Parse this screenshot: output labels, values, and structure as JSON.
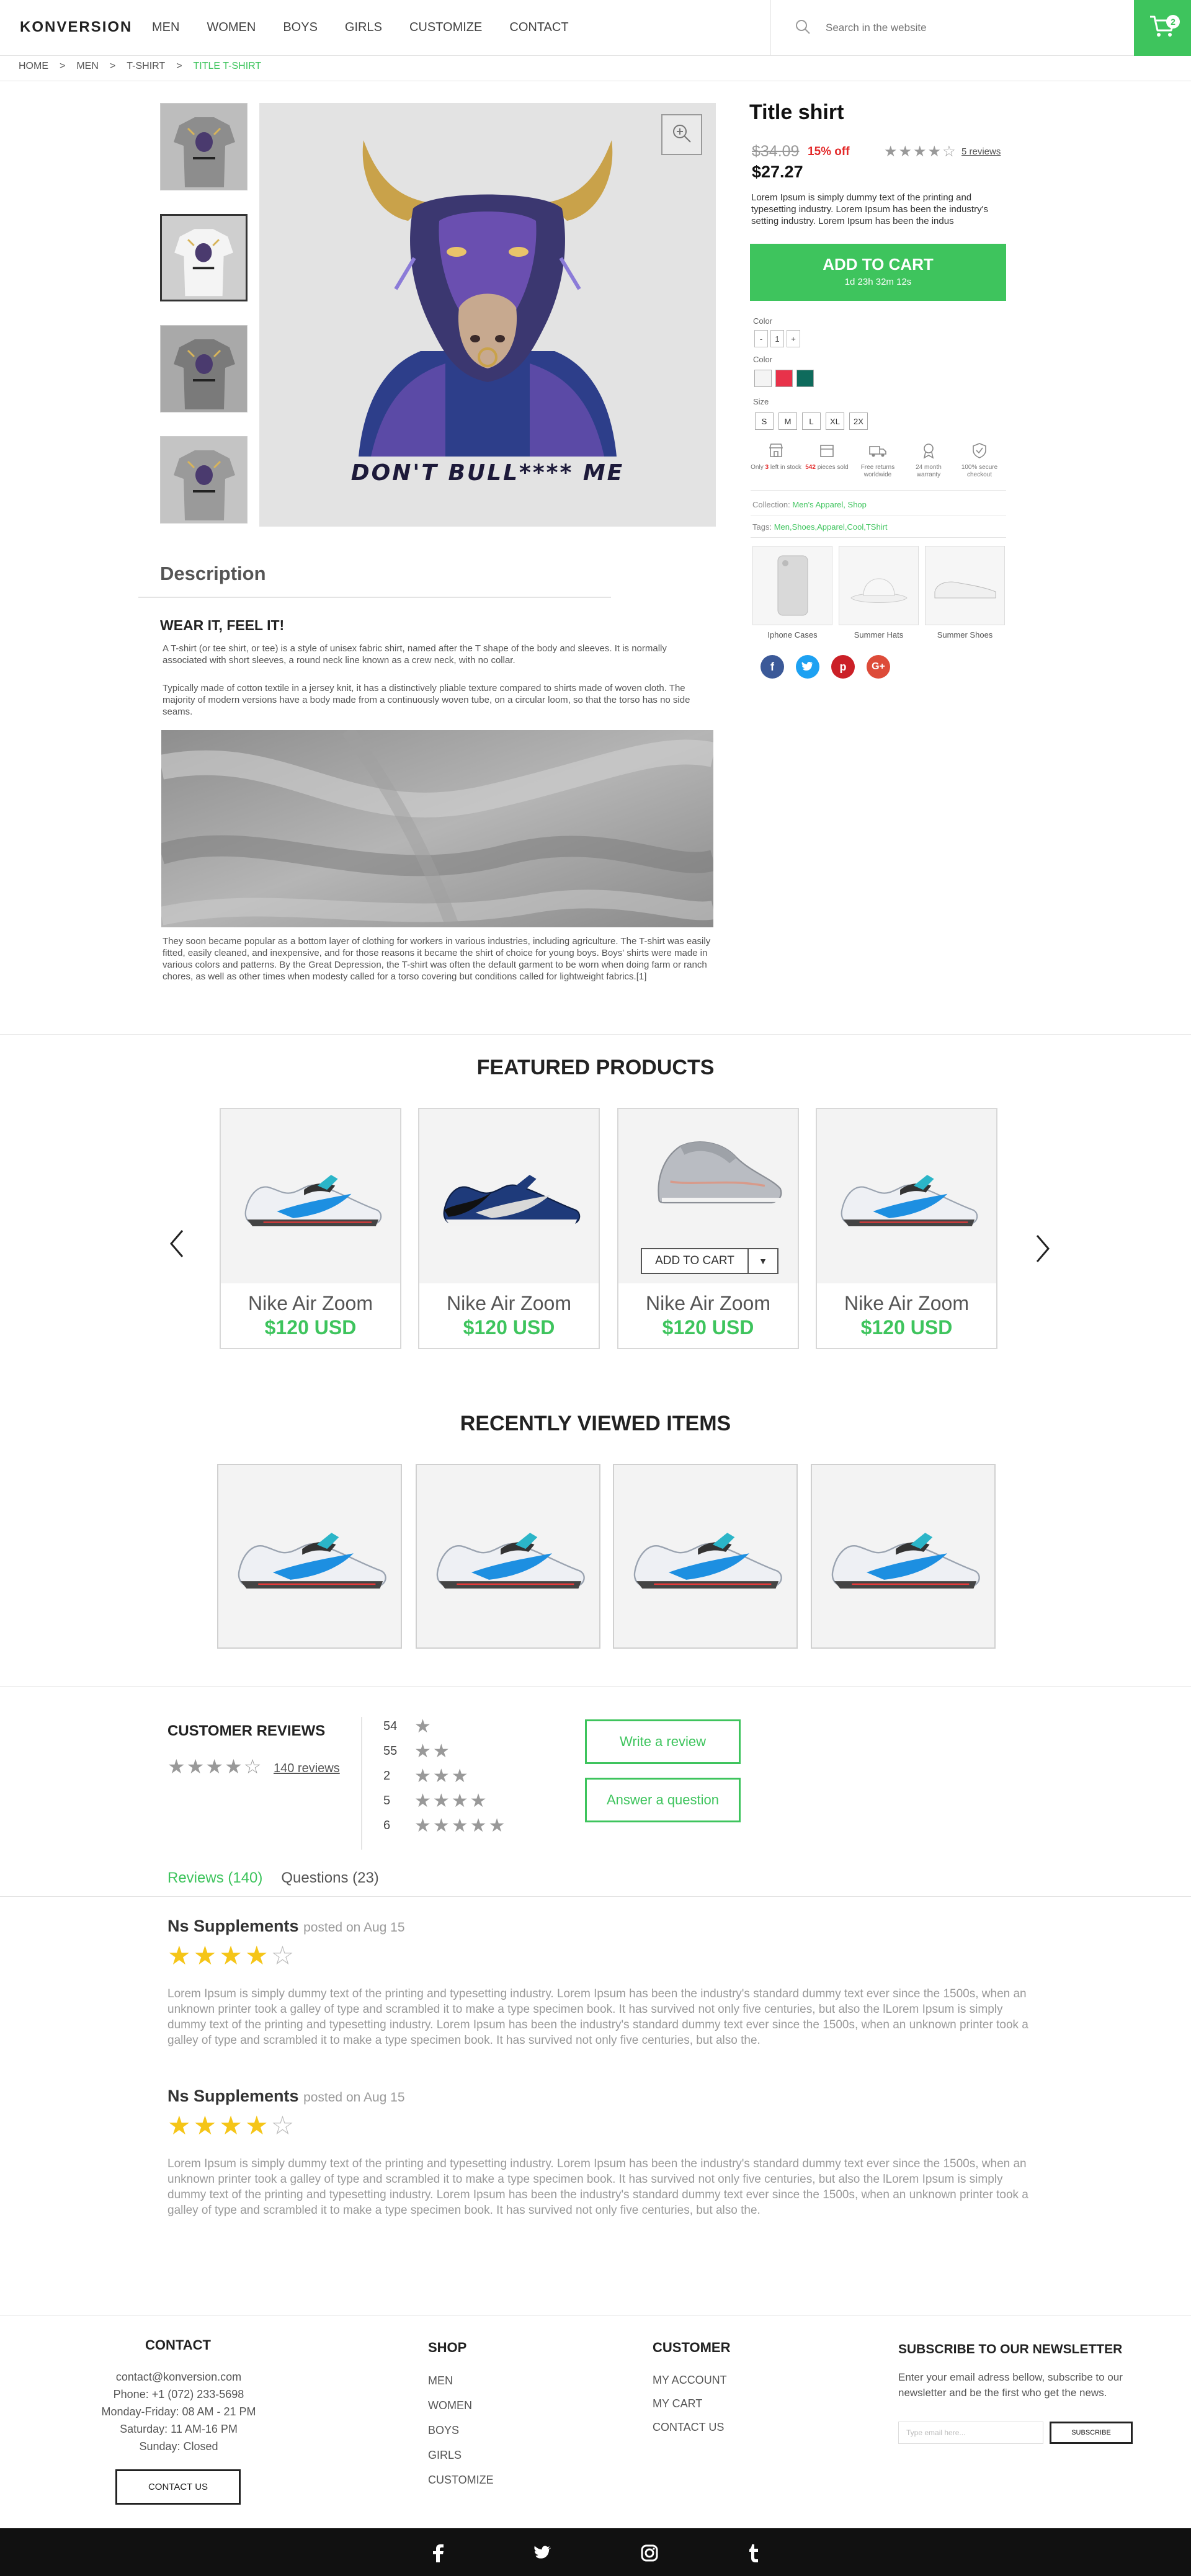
{
  "header": {
    "logo": "KONVERSION",
    "nav": [
      "MEN",
      "WOMEN",
      "BOYS",
      "GIRLS",
      "CUSTOMIZE",
      "CONTACT"
    ],
    "search_placeholder": "Search in the website",
    "cart_count": "2"
  },
  "breadcrumb": [
    "HOME",
    ">",
    "MEN",
    ">",
    "T-SHIRT",
    ">",
    "TITLE T-SHIRT"
  ],
  "product": {
    "tshirt_print": "DON'T BULL**** ME",
    "title": "Title shirt",
    "old_price": "$34.09",
    "discount": "15% off",
    "new_price": "$27.27",
    "rating_stars": "★★★★☆",
    "reviews_link": "5 reviews",
    "description": "Lorem Ipsum is simply dummy text of the printing and typesetting industry. Lorem Ipsum has been the industry's setting industry. Lorem Ipsum has been the indus",
    "add_to_cart": "ADD TO CART",
    "countdown": "1d 23h 32m 12s",
    "qty_label": "Color",
    "qty": [
      "-",
      "1",
      "+"
    ],
    "color_label": "Color",
    "colors": [
      "#f4f4f4",
      "#e8324a",
      "#0e6b5c"
    ],
    "size_label": "Size",
    "sizes": [
      "S",
      "M",
      "L",
      "XL",
      "2X"
    ],
    "features": [
      {
        "pre": "Only ",
        "hl": "3",
        "post": " left in stock",
        "icon": "store-icon"
      },
      {
        "pre": "",
        "hl": "542",
        "post": " pieces sold",
        "icon": "box-icon"
      },
      {
        "pre": "",
        "hl": "",
        "post": "Free returns worldwide",
        "icon": "truck-icon"
      },
      {
        "pre": "",
        "hl": "",
        "post": "24 month warranty",
        "icon": "medal-icon"
      },
      {
        "pre": "",
        "hl": "",
        "post": "100% secure checkout",
        "icon": "shield-icon"
      }
    ],
    "collection_label": "Collection:",
    "collection_value": "Men's Apparel, Shop",
    "tags_label": "Tags:",
    "tags_value": "Men,Shoes,Apparel,Cool,TShirt",
    "related": [
      "Iphone Cases",
      "Summer Hats",
      "Summer Shoes"
    ]
  },
  "description": {
    "title": "Description",
    "subtitle": "WEAR IT, FEEL IT!",
    "p1": "A T-shirt (or tee shirt, or tee) is a style of unisex fabric shirt, named after the T shape of the body and sleeves. It is normally associated with short sleeves, a round neck line known as a crew neck, with no collar.",
    "p2": "Typically made of cotton textile in a jersey knit, it has a distinctively pliable texture compared to shirts made of woven cloth. The majority of modern versions have a body made from a continuously woven tube, on a circular loom, so that the torso has no side seams.",
    "p3": "They soon became popular as a bottom layer of clothing for workers in various industries, including agriculture. The T-shirt was easily fitted, easily cleaned, and inexpensive, and for those reasons it became the shirt of choice for young boys. Boys' shirts were made in various colors and patterns. By the Great Depression, the T-shirt was often the default garment to be worn when doing farm or ranch chores, as well as other times when modesty called for a torso covering but conditions called for lightweight fabrics.[1]"
  },
  "featured": {
    "title": "FEATURED PRODUCTS",
    "add_to_cart": "ADD TO CART",
    "items": [
      {
        "name": "Nike Air Zoom",
        "price": "$120 USD"
      },
      {
        "name": "Nike Air Zoom",
        "price": "$120 USD"
      },
      {
        "name": "Nike Air Zoom",
        "price": "$120 USD"
      },
      {
        "name": "Nike Air Zoom",
        "price": "$120 USD"
      }
    ]
  },
  "recent": {
    "title": "RECENTLY VIEWED ITEMS"
  },
  "reviews": {
    "title": "CUSTOMER REVIEWS",
    "stars": "★★★★☆",
    "count_link": "140 reviews",
    "breakdown": [
      {
        "count": "54",
        "stars": "★"
      },
      {
        "count": "55",
        "stars": "★★"
      },
      {
        "count": "2",
        "stars": "★★★"
      },
      {
        "count": "5",
        "stars": "★★★★"
      },
      {
        "count": "6",
        "stars": "★★★★★"
      }
    ],
    "write_btn": "Write a review",
    "answer_btn": "Answer a question",
    "tab_reviews": "Reviews (140)",
    "tab_questions": "Questions (23)",
    "items": [
      {
        "author": "Ns Supplements",
        "date": "posted on Aug 15",
        "filled": "★★★★",
        "empty": "☆",
        "text": "Lorem Ipsum is simply dummy text of the printing and typesetting industry. Lorem Ipsum has been the industry's standard dummy text ever since the 1500s, when an unknown printer took a galley of type and scrambled it to make a type specimen book. It has survived not only five centuries, but also the lLorem Ipsum is simply dummy text of the printing and typesetting industry. Lorem Ipsum has been the industry's standard dummy text ever since the 1500s, when an unknown printer took a galley of type and scrambled it to make a type specimen book. It has survived not only five centuries, but also the."
      },
      {
        "author": "Ns Supplements",
        "date": "posted on Aug 15",
        "filled": "★★★★",
        "empty": "☆",
        "text": "Lorem Ipsum is simply dummy text of the printing and typesetting industry. Lorem Ipsum has been the industry's standard dummy text ever since the 1500s, when an unknown printer took a galley of type and scrambled it to make a type specimen book. It has survived not only five centuries, but also the lLorem Ipsum is simply dummy text of the printing and typesetting industry. Lorem Ipsum has been the industry's standard dummy text ever since the 1500s, when an unknown printer took a galley of type and scrambled it to make a type specimen book. It has survived not only five centuries, but also the."
      }
    ]
  },
  "footer": {
    "contact_title": "CONTACT",
    "contact_lines": [
      "contact@konversion.com",
      "Phone: +1 (072) 233-5698",
      "Monday-Friday: 08 AM - 21 PM",
      "Saturday: 11 AM-16 PM",
      "Sunday: Closed"
    ],
    "contact_btn": "CONTACT US",
    "shop_title": "SHOP",
    "shop_links": [
      "MEN",
      "WOMEN",
      "BOYS",
      "GIRLS",
      "CUSTOMIZE"
    ],
    "customer_title": "CUSTOMER",
    "customer_links": [
      "MY ACCOUNT",
      "MY CART",
      "CONTACT US"
    ],
    "newsletter_title": "SUBSCRIBE TO OUR NEWSLETTER",
    "newsletter_text": "Enter your email adress bellow, subscribe to our newsletter and be the first who get the news.",
    "newsletter_placeholder": "Type email here...",
    "subscribe_btn": "SUBSCRIBE",
    "social": [
      "f",
      "t",
      "ig",
      "T"
    ]
  },
  "colors": {
    "accent": "#3ec45d",
    "sale": "#e32a2a",
    "dark": "#111111"
  }
}
